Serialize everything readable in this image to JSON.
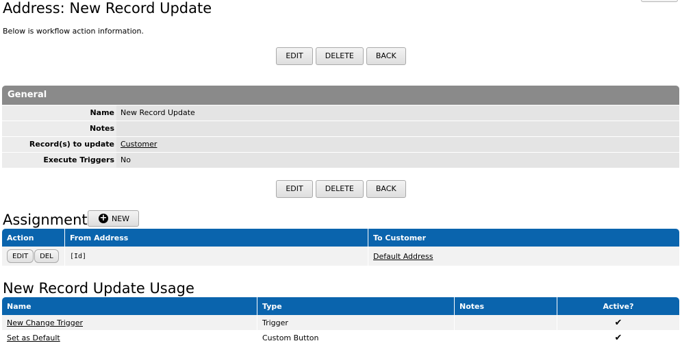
{
  "page": {
    "title": "Address: New Record Update",
    "intro": "Below is workflow action information."
  },
  "actions": {
    "edit_label": "EDIT",
    "delete_label": "DELETE",
    "back_label": "BACK"
  },
  "general": {
    "header": "General",
    "fields": [
      {
        "label": "Name",
        "value": "New Record Update"
      },
      {
        "label": "Notes",
        "value": ""
      },
      {
        "label": "Record(s) to update",
        "value": "Customer"
      },
      {
        "label": "Execute Triggers",
        "value": "No"
      }
    ]
  },
  "assignments": {
    "title": "Assignments",
    "new_label": "NEW",
    "columns": [
      "Action",
      "From Address",
      "To Customer"
    ],
    "row": {
      "edit_label": "EDIT",
      "del_label": "DEL",
      "from": "[Id]",
      "to": "Default Address"
    }
  },
  "usage": {
    "title": "New Record Update Usage",
    "columns": [
      "Name",
      "Type",
      "Notes",
      "Active?"
    ],
    "rows": [
      {
        "name": "New Change Trigger",
        "type": "Trigger",
        "notes": "",
        "active_icon": "checkmark",
        "active": "✔"
      },
      {
        "name": "Set as Default",
        "type": "Custom Button",
        "notes": "",
        "active_icon": "checkmark",
        "active": "✔"
      }
    ]
  },
  "colors": {
    "panel_header": "#8a8a8a",
    "grid_header": "#0a64ad"
  }
}
